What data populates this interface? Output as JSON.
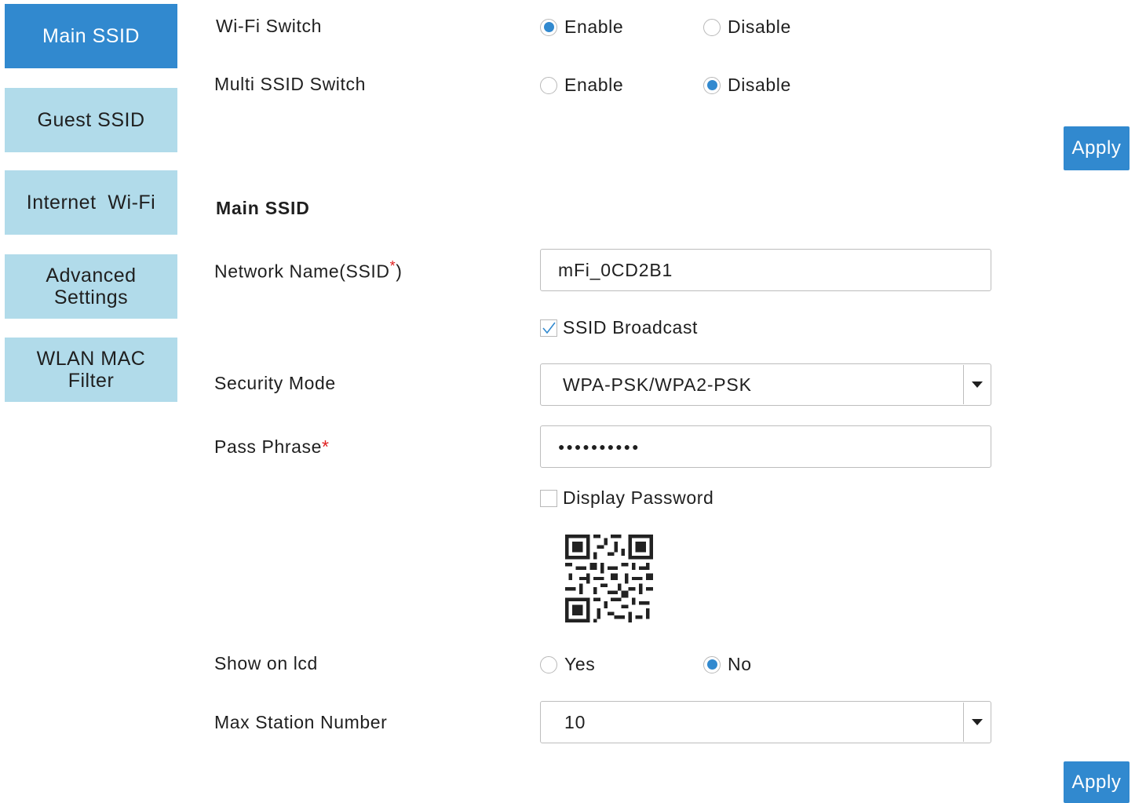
{
  "sidebar": {
    "items": [
      {
        "label": "Main SSID",
        "active": true
      },
      {
        "label": "Guest SSID",
        "active": false
      },
      {
        "label": "Internet  Wi-Fi",
        "active": false
      },
      {
        "label": "Advanced Settings",
        "active": false
      },
      {
        "label": "WLAN MAC Filter",
        "active": false
      }
    ]
  },
  "switches": {
    "wifi": {
      "label": "Wi-Fi Switch",
      "options": [
        "Enable",
        "Disable"
      ],
      "selected": "Enable"
    },
    "multi_ssid": {
      "label": "Multi SSID Switch",
      "options": [
        "Enable",
        "Disable"
      ],
      "selected": "Disable"
    },
    "apply_label": "Apply"
  },
  "main_ssid": {
    "title": "Main SSID",
    "network_name": {
      "label": "Network Name(SSID",
      "label_close": ")",
      "required_mark": "*",
      "value": "mFi_0CD2B1"
    },
    "ssid_broadcast": {
      "label": "SSID Broadcast",
      "checked": true
    },
    "security_mode": {
      "label": "Security Mode",
      "value": "WPA-PSK/WPA2-PSK"
    },
    "pass_phrase": {
      "label": "Pass Phrase",
      "required_mark": "*",
      "value": "●●●●●●●●●●"
    },
    "display_password": {
      "label": "Display Password",
      "checked": false
    },
    "show_on_lcd": {
      "label": "Show on lcd",
      "options": [
        "Yes",
        "No"
      ],
      "selected": "No"
    },
    "max_station": {
      "label": "Max Station Number",
      "value": "10"
    },
    "apply_label": "Apply"
  },
  "colors": {
    "accent": "#3189cf",
    "sidebar_inactive": "#b1dbea",
    "required": "#e02020"
  }
}
